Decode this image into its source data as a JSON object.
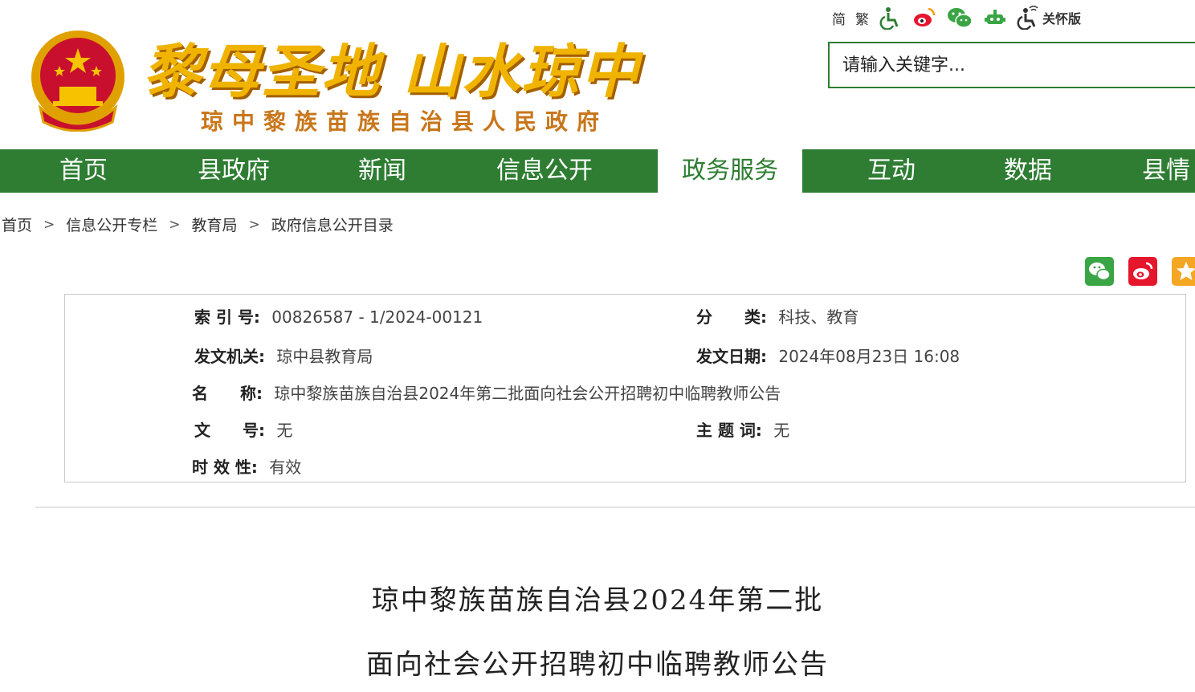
{
  "header": {
    "slogan": "黎母圣地 山水琼中",
    "subtitle": "琼中黎族苗族自治县人民政府",
    "toolbar": {
      "simplified": "简",
      "traditional": "繁",
      "care_label": "关怀版"
    },
    "search": {
      "placeholder": "请输入关键字..."
    }
  },
  "nav": {
    "items": [
      {
        "label": "首页"
      },
      {
        "label": "县政府"
      },
      {
        "label": "新闻"
      },
      {
        "label": "信息公开"
      },
      {
        "label": "政务服务",
        "active": true
      },
      {
        "label": "互动"
      },
      {
        "label": "数据"
      },
      {
        "label": "县情"
      }
    ]
  },
  "breadcrumb": {
    "items": [
      "首页",
      "信息公开专栏",
      "教育局",
      "政府信息公开目录"
    ],
    "separator": ">"
  },
  "meta": {
    "index_label": "索 引 号:",
    "index_value": "00826587 - 1/2024-00121",
    "category_label": "分　　类:",
    "category_value": "科技、教育",
    "issuer_label": "发文机关:",
    "issuer_value": "琼中县教育局",
    "date_label": "发文日期:",
    "date_value": "2024年08月23日 16:08",
    "name_label": "名　　称:",
    "name_value": "琼中黎族苗族自治县2024年第二批面向社会公开招聘初中临聘教师公告",
    "doc_no_label": "文　　号:",
    "doc_no_value": "无",
    "subject_label": "主 题 词:",
    "subject_value": "无",
    "validity_label": "时 效 性:",
    "validity_value": "有效"
  },
  "article": {
    "title_line1": "琼中黎族苗族自治县2024年第二批",
    "title_line2": "面向社会公开招聘初中临聘教师公告"
  },
  "colors": {
    "nav_green": "#2e7d32",
    "slogan_gold": "#f0b400",
    "subtitle_orange": "#c8761a"
  }
}
